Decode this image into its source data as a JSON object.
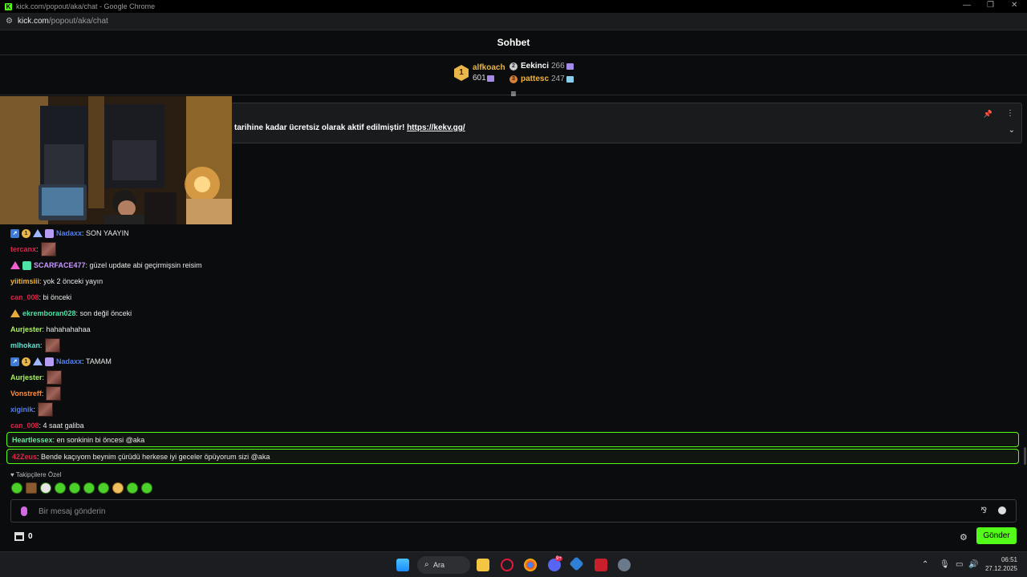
{
  "window": {
    "title": "kick.com/popout/aka/chat - Google Chrome",
    "url_host": "kick.com",
    "url_path": "/popout/aka/chat"
  },
  "chat": {
    "title": "Sohbet"
  },
  "leaderboard": {
    "first": {
      "rank": "1",
      "name": "alfkoach",
      "amount": "601"
    },
    "second": {
      "rank": "2",
      "name": "Eekinci",
      "amount": "266"
    },
    "third": {
      "rank": "3",
      "name": "pattesc",
      "amount": "247"
    }
  },
  "pinned": {
    "text": "tarihine kadar ücretsiz olarak aktif edilmiştir! ",
    "link": "https://kekv.gg/"
  },
  "messages": [
    {
      "user": "Nadaxx",
      "color": "#4f7ff0",
      "text": "SON YAAYIN"
    },
    {
      "user": "tercanx",
      "color": "#e0244a",
      "text": ""
    },
    {
      "user": "SCARFACE477",
      "color": "#c89bff",
      "text": "güzel update abi geçirmişsin reisim"
    },
    {
      "user": "yiitimsiii",
      "color": "#f0b43c",
      "text": "yok 2 önceki yayın"
    },
    {
      "user": "can_008",
      "color": "#e0244a",
      "text": "bi önceki"
    },
    {
      "user": "ekremboran028",
      "color": "#4ee1a8",
      "text": "son değil önceki"
    },
    {
      "user": "Aurjester",
      "color": "#a8f060",
      "text": "hahahahahaa"
    },
    {
      "user": "mlhokan",
      "color": "#5ee0d0",
      "text": ""
    },
    {
      "user": "Nadaxx",
      "color": "#4f7ff0",
      "text": "TAMAM"
    },
    {
      "user": "Aurjester",
      "color": "#a8f060",
      "text": ""
    },
    {
      "user": "Vonstreff",
      "color": "#ff8a3c",
      "text": ""
    },
    {
      "user": "xiginik",
      "color": "#4f7ff0",
      "text": ""
    },
    {
      "user": "can_008",
      "color": "#e0244a",
      "text": "4 saat galiba"
    }
  ],
  "highlighted": [
    {
      "user": "Heartlessex",
      "color": "#6fe0a0",
      "text": "en sonkinin bi öncesi @aka"
    },
    {
      "user": "42Zeus",
      "color": "#e0244a",
      "text": "Bende kaçıyom beynim çürüdü herkese iyi geceler öpüyorum sizi @aka"
    }
  ],
  "followers_only": "Takipçilere Özel",
  "composer": {
    "placeholder": "Bir mesaj gönderin"
  },
  "bottom": {
    "points": "0",
    "send_label": "Gönder"
  },
  "taskbar": {
    "search_label": "Ara",
    "time": "06:51",
    "date": "27.12.2025",
    "discord_badge": "9+"
  },
  "colors": {
    "accent": "#53fc18",
    "background": "#0b0c0d"
  }
}
